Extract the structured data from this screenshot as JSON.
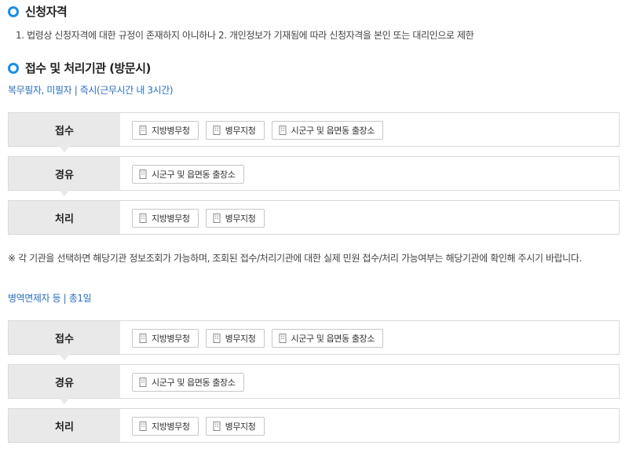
{
  "section1": {
    "title": "신청자격",
    "text": "1. 법령상 신청자격에 대한 규정이 존재하지 아니하나 2. 개인정보가 기재됨에 따라 신청자격을 본인 또는 대리인으로 제한"
  },
  "section2": {
    "title": "접수 및 처리기관 (방문시)",
    "group1": {
      "meta": "복무필자, 미필자 | 즉시(근무시간 내 3시간)",
      "rows": [
        {
          "label": "접수",
          "chips": [
            "지방병무청",
            "병무지청",
            "시군구 및 읍면동 출장소"
          ]
        },
        {
          "label": "경유",
          "chips": [
            "시군구 및 읍면동 출장소"
          ]
        },
        {
          "label": "처리",
          "chips": [
            "지방병무청",
            "병무지청"
          ]
        }
      ]
    },
    "note": "※ 각 기관을 선택하면 해당기관 정보조회가 가능하며, 조회된 접수/처리기관에 대한 실제 민원 접수/처리 가능여부는 해당기관에 확인해 주시기 바랍니다.",
    "group2": {
      "meta": "병역면제자 등 | 총1일",
      "rows": [
        {
          "label": "접수",
          "chips": [
            "지방병무청",
            "병무지청",
            "시군구 및 읍면동 출장소"
          ]
        },
        {
          "label": "경유",
          "chips": [
            "시군구 및 읍면동 출장소"
          ]
        },
        {
          "label": "처리",
          "chips": [
            "지방병무청",
            "병무지청"
          ]
        }
      ]
    }
  },
  "icons": {
    "section_bullet": "ring-bullet-icon",
    "chip": "building-icon"
  },
  "colors": {
    "accent": "#1a8ee8",
    "meta_link": "#2a6ebf",
    "label_bg": "#e9e9e9"
  }
}
